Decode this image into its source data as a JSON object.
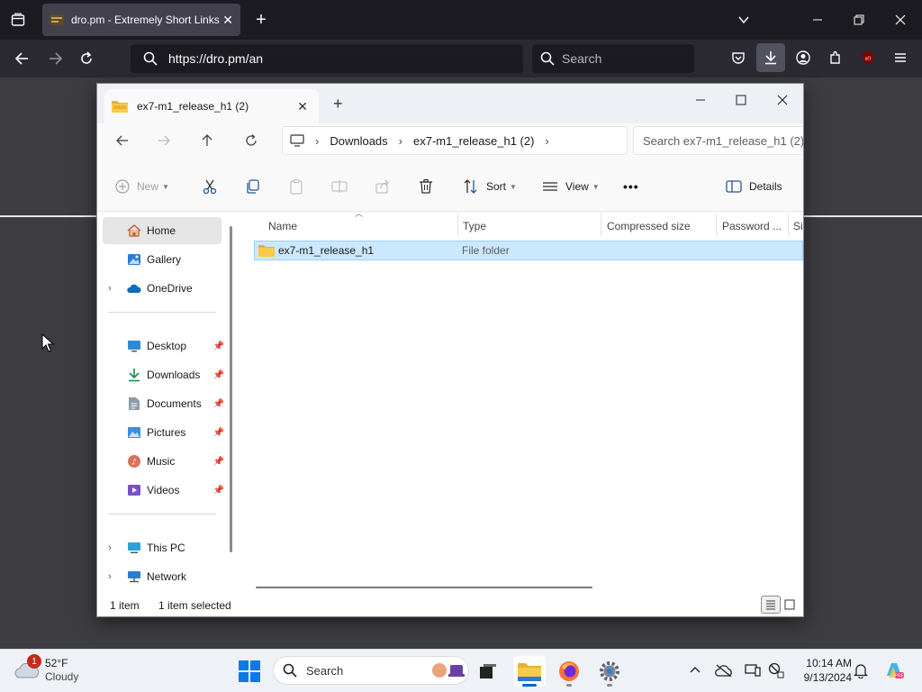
{
  "browser": {
    "tab_title": "dro.pm - Extremely Short Links",
    "url": "https://dro.pm/an",
    "search_placeholder": "Search"
  },
  "explorer": {
    "tab_title": "ex7-m1_release_h1 (2)",
    "breadcrumb": [
      "Downloads",
      "ex7-m1_release_h1 (2)"
    ],
    "search_placeholder": "Search ex7-m1_release_h1 (2)",
    "toolbar": {
      "new_label": "New",
      "sort_label": "Sort",
      "view_label": "View",
      "more_label": "•••",
      "details_label": "Details"
    },
    "sidebar": {
      "top": [
        {
          "label": "Home",
          "icon": "home-icon",
          "active": true
        },
        {
          "label": "Gallery",
          "icon": "gallery-icon"
        },
        {
          "label": "OneDrive",
          "icon": "onedrive-icon",
          "expandable": true
        }
      ],
      "pinned": [
        {
          "label": "Desktop",
          "icon": "desktop-icon"
        },
        {
          "label": "Downloads",
          "icon": "downloads-icon"
        },
        {
          "label": "Documents",
          "icon": "documents-icon"
        },
        {
          "label": "Pictures",
          "icon": "pictures-icon"
        },
        {
          "label": "Music",
          "icon": "music-icon"
        },
        {
          "label": "Videos",
          "icon": "videos-icon"
        }
      ],
      "bottom": [
        {
          "label": "This PC",
          "icon": "this-pc-icon",
          "expandable": true
        },
        {
          "label": "Network",
          "icon": "network-icon",
          "expandable": true
        }
      ]
    },
    "columns": [
      "Name",
      "Type",
      "Compressed size",
      "Password ...",
      "Si"
    ],
    "files": [
      {
        "name": "ex7-m1_release_h1",
        "type": "File folder",
        "selected": true
      }
    ],
    "status": {
      "item_count": "1 item",
      "selected_count": "1 item selected"
    }
  },
  "taskbar": {
    "weather_temp": "52°F",
    "weather_desc": "Cloudy",
    "weather_badge": "1",
    "search_placeholder": "Search",
    "time": "10:14 AM",
    "date": "9/13/2024"
  },
  "colors": {
    "selection_bg": "#cce8ff",
    "selection_border": "#99d1ff",
    "folder_yellow": "#f8c94a",
    "accent_blue": "#0067c0"
  }
}
